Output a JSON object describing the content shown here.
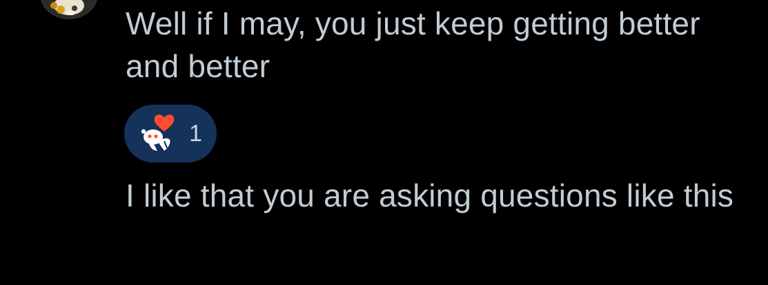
{
  "comment_thread": {
    "messages": [
      {
        "text": "Well if I may, you just keep getting better and better"
      },
      {
        "text": "I like that you are asking questions like this"
      }
    ],
    "reaction": {
      "icon": "heart-snoo-icon",
      "count": "1"
    }
  },
  "colors": {
    "background": "#000000",
    "message_text": "#c2ccd4",
    "reaction_pill": "#14325a",
    "heart": "#ff4d2e"
  }
}
